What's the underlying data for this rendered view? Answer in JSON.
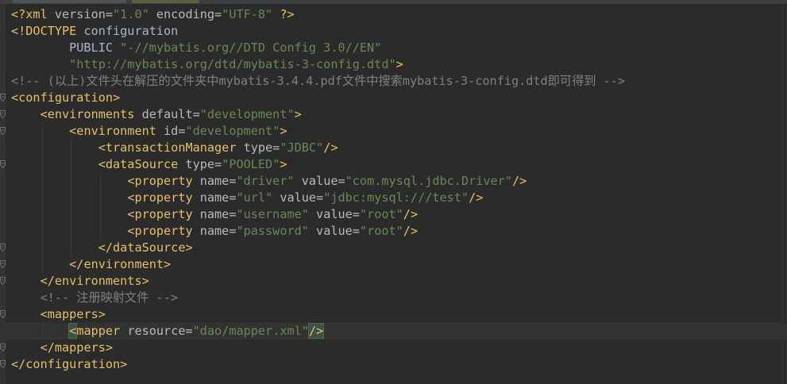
{
  "editor": {
    "lines": [
      [
        {
          "c": "t-tag",
          "t": "<?xml "
        },
        {
          "c": "t-attr",
          "t": "version="
        },
        {
          "c": "t-str",
          "t": "\"1.0\""
        },
        {
          "c": "t-attr",
          "t": " encoding="
        },
        {
          "c": "t-str",
          "t": "\"UTF-8\""
        },
        {
          "c": "t-tag",
          "t": " ?>"
        }
      ],
      [
        {
          "c": "t-tag",
          "t": "<!DOCTYPE "
        },
        {
          "c": "t-plain",
          "t": "configuration"
        }
      ],
      [
        {
          "c": "t-plain",
          "t": "        PUBLIC "
        },
        {
          "c": "t-str",
          "t": "\"-//mybatis.org//DTD Config 3.0//EN\""
        }
      ],
      [
        {
          "c": "t-str",
          "t": "        \"http://mybatis.org/dtd/mybatis-3-config.dtd\""
        },
        {
          "c": "t-tag",
          "t": ">"
        }
      ],
      [
        {
          "c": "t-cmt",
          "t": "<!-- (以上)文件头在解压的文件夹中mybatis-3.4.4.pdf文件中搜索mybatis-3-config.dtd即可得到 -->"
        }
      ],
      [
        {
          "c": "t-tag",
          "t": "<configuration>"
        }
      ],
      [
        {
          "c": "t-plain",
          "t": "    "
        },
        {
          "c": "t-tag",
          "t": "<environments "
        },
        {
          "c": "t-attr",
          "t": "default="
        },
        {
          "c": "t-str",
          "t": "\"development\""
        },
        {
          "c": "t-tag",
          "t": ">"
        }
      ],
      [
        {
          "c": "t-plain",
          "t": "        "
        },
        {
          "c": "t-tag",
          "t": "<environment "
        },
        {
          "c": "t-attr",
          "t": "id="
        },
        {
          "c": "t-str",
          "t": "\"development\""
        },
        {
          "c": "t-tag",
          "t": ">"
        }
      ],
      [
        {
          "c": "t-plain",
          "t": "            "
        },
        {
          "c": "t-tag",
          "t": "<transactionManager "
        },
        {
          "c": "t-attr",
          "t": "type="
        },
        {
          "c": "t-str",
          "t": "\"JDBC\""
        },
        {
          "c": "t-tag",
          "t": "/>"
        }
      ],
      [
        {
          "c": "t-plain",
          "t": "            "
        },
        {
          "c": "t-tag",
          "t": "<dataSource "
        },
        {
          "c": "t-attr",
          "t": "type="
        },
        {
          "c": "t-str",
          "t": "\"POOLED\""
        },
        {
          "c": "t-tag",
          "t": ">"
        }
      ],
      [
        {
          "c": "t-plain",
          "t": "                "
        },
        {
          "c": "t-tag",
          "t": "<property "
        },
        {
          "c": "t-attr",
          "t": "name="
        },
        {
          "c": "t-str",
          "t": "\"driver\""
        },
        {
          "c": "t-attr",
          "t": " value="
        },
        {
          "c": "t-str",
          "t": "\"com.mysql.jdbc.Driver\""
        },
        {
          "c": "t-tag",
          "t": "/>"
        }
      ],
      [
        {
          "c": "t-plain",
          "t": "                "
        },
        {
          "c": "t-tag",
          "t": "<property "
        },
        {
          "c": "t-attr",
          "t": "name="
        },
        {
          "c": "t-str",
          "t": "\"url\""
        },
        {
          "c": "t-attr",
          "t": " value="
        },
        {
          "c": "t-str",
          "t": "\"jdbc:mysql:///test\""
        },
        {
          "c": "t-tag",
          "t": "/>"
        }
      ],
      [
        {
          "c": "t-plain",
          "t": "                "
        },
        {
          "c": "t-tag",
          "t": "<property "
        },
        {
          "c": "t-attr",
          "t": "name="
        },
        {
          "c": "t-str",
          "t": "\"username\""
        },
        {
          "c": "t-attr",
          "t": " value="
        },
        {
          "c": "t-str",
          "t": "\"root\""
        },
        {
          "c": "t-tag",
          "t": "/>"
        }
      ],
      [
        {
          "c": "t-plain",
          "t": "                "
        },
        {
          "c": "t-tag",
          "t": "<property "
        },
        {
          "c": "t-attr",
          "t": "name="
        },
        {
          "c": "t-str",
          "t": "\"password\""
        },
        {
          "c": "t-attr",
          "t": " value="
        },
        {
          "c": "t-str",
          "t": "\"root\""
        },
        {
          "c": "t-tag",
          "t": "/>"
        }
      ],
      [
        {
          "c": "t-plain",
          "t": "            "
        },
        {
          "c": "t-tag",
          "t": "</dataSource>"
        }
      ],
      [
        {
          "c": "t-plain",
          "t": "        "
        },
        {
          "c": "t-tag",
          "t": "</environment>"
        }
      ],
      [
        {
          "c": "t-plain",
          "t": "    "
        },
        {
          "c": "t-tag",
          "t": "</environments>"
        }
      ],
      [
        {
          "c": "t-plain",
          "t": "    "
        },
        {
          "c": "t-cmt",
          "t": "<!-- 注册映射文件 -->"
        }
      ],
      [
        {
          "c": "t-plain",
          "t": "    "
        },
        {
          "c": "t-tag",
          "t": "<mappers>"
        }
      ],
      [
        {
          "c": "t-plain",
          "t": "        "
        },
        {
          "c": "match",
          "t": "<"
        },
        {
          "c": "t-tag",
          "t": "mapper "
        },
        {
          "c": "t-attr",
          "t": "resource="
        },
        {
          "c": "t-str",
          "t": "\"dao/mapper.xml\""
        },
        {
          "c": "match",
          "t": "/>"
        }
      ],
      [
        {
          "c": "t-plain",
          "t": "    "
        },
        {
          "c": "t-tag",
          "t": "</mappers>"
        }
      ],
      [
        {
          "c": "t-tag",
          "t": "</configuration>"
        }
      ]
    ],
    "highlighted_line": 20,
    "fold_markers": [
      6,
      7,
      8,
      10,
      15,
      16,
      17,
      19,
      21,
      22
    ],
    "colors": {
      "background": "#2b2b2b",
      "tag": "#e8bf6a",
      "attribute": "#bababa",
      "string": "#6a8759",
      "comment": "#808080",
      "current_line": "#323232",
      "brace_match": "#3b514d"
    }
  }
}
